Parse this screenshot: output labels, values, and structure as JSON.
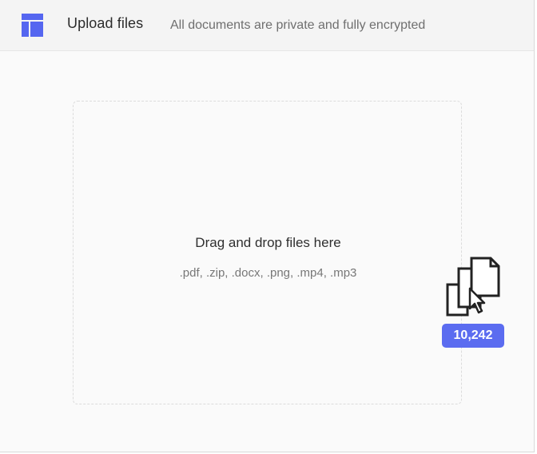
{
  "header": {
    "title": "Upload files",
    "subtitle": "All documents are private and fully encrypted",
    "icon": "layout-grid-icon"
  },
  "dropzone": {
    "title": "Drag and drop files here",
    "accepted_types": ".pdf, .zip, .docx, .png, .mp4, .mp3"
  },
  "drag_preview": {
    "icon": "stacked-files-with-cursor-icon",
    "count": "10,242"
  },
  "colors": {
    "accent": "#5b6cf0",
    "background": "#fafafa",
    "header_background": "#f4f4f4"
  }
}
